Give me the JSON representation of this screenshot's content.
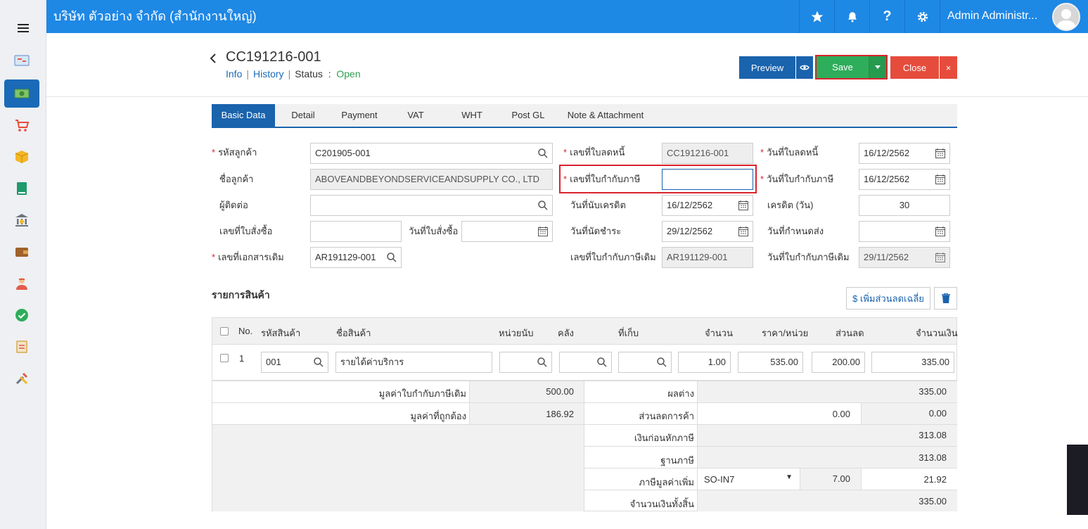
{
  "app": {
    "company": "บริษัท ตัวอย่าง จำกัด (สำนักงานใหญ่)",
    "user": "Admin Administr..."
  },
  "sidebar": {
    "items": [
      {
        "icon": "dashboard-icon"
      },
      {
        "icon": "money-icon",
        "active": true
      },
      {
        "icon": "cart-icon"
      },
      {
        "icon": "box-icon"
      },
      {
        "icon": "book-icon"
      },
      {
        "icon": "bank-icon"
      },
      {
        "icon": "wallet-icon"
      },
      {
        "icon": "user-icon"
      },
      {
        "icon": "approve-icon"
      },
      {
        "icon": "transfer-icon"
      },
      {
        "icon": "tools-icon"
      }
    ]
  },
  "header": {
    "doc_no": "CC191216-001",
    "info": "Info",
    "history": "History",
    "status_label": "Status",
    "status_colon": ":",
    "status_value": "Open",
    "sep": "|"
  },
  "actions": {
    "preview": "Preview",
    "save": "Save",
    "close": "Close"
  },
  "tabs": [
    "Basic Data",
    "Detail",
    "Payment",
    "VAT",
    "WHT",
    "Post GL",
    "Note & Attachment"
  ],
  "form": {
    "customer_code_label": "รหัสลูกค้า",
    "customer_code": "C201905-001",
    "customer_name_label": "ชื่อลูกค้า",
    "customer_name": "ABOVEANDBEYONDSERVICEANDSUPPLY CO., LTD",
    "contact_label": "ผู้ติดต่อ",
    "contact": "",
    "po_no_label": "เลขที่ใบสั่งซื้อ",
    "po_no": "",
    "po_date_label": "วันที่ใบสั่งซื้อ",
    "po_date": "",
    "ref_doc_label": "เลขที่เอกสารเดิม",
    "ref_doc": "AR191129-001",
    "cn_no_label": "เลขที่ใบลดหนี้",
    "cn_no": "CC191216-001",
    "tax_inv_no_label": "เลขที่ใบกำกับภาษี",
    "tax_inv_no": "",
    "credit_start_label": "วันที่นับเครดิต",
    "credit_start": "16/12/2562",
    "due_date_label": "วันที่นัดชำระ",
    "due_date": "29/12/2562",
    "ref_tax_inv_label": "เลขที่ใบกำกับภาษีเดิม",
    "ref_tax_inv": "AR191129-001",
    "cn_date_label": "วันที่ใบลดหนี้",
    "cn_date": "16/12/2562",
    "tax_inv_date_label": "วันที่ใบกำกับภาษี",
    "tax_inv_date": "16/12/2562",
    "credit_days_label": "เครดิต (วัน)",
    "credit_days": "30",
    "delivery_date_label": "วันที่กำหนดส่ง",
    "delivery_date": "",
    "ref_tax_inv_date_label": "วันที่ใบกำกับภาษีเดิม",
    "ref_tax_inv_date": "29/11/2562"
  },
  "items": {
    "title": "รายการสินค้า",
    "add_discount": "$ เพิ่มส่วนลดเฉลี่ย",
    "columns": [
      "No.",
      "รหัสสินค้า",
      "ชื่อสินค้า",
      "หน่วยนับ",
      "คลัง",
      "ที่เก็บ",
      "จำนวน",
      "ราคา/หน่วย",
      "ส่วนลด",
      "จำนวนเงิน"
    ],
    "rows": [
      {
        "no": "1",
        "code": "001",
        "name": "รายได้ค่าบริการ",
        "unit": "",
        "warehouse": "",
        "location": "",
        "qty": "1.00",
        "price": "535.00",
        "discount": "200.00",
        "amount": "335.00"
      }
    ]
  },
  "summary": {
    "orig_tax_value_label": "มูลค่าใบกำกับภาษีเดิม",
    "orig_tax_value": "500.00",
    "correct_value_label": "มูลค่าที่ถูกต้อง",
    "correct_value": "186.92",
    "diff_label": "ผลต่าง",
    "diff": "335.00",
    "trade_discount_label": "ส่วนลดการค้า",
    "trade_discount_input": "0.00",
    "trade_discount": "0.00",
    "before_tax_label": "เงินก่อนหักภาษี",
    "before_tax": "313.08",
    "tax_base_label": "ฐานภาษี",
    "tax_base": "313.08",
    "vat_label": "ภาษีมูลค่าเพิ่ม",
    "vat_code": "SO-IN7",
    "vat_rate": "7.00",
    "vat_amount": "21.92",
    "total_label": "จำนวนเงินทั้งสิ้น",
    "total": "335.00"
  },
  "colors": {
    "topbar": "#1e88e5",
    "primary": "#1a63ad",
    "save": "#2ead5a",
    "close": "#e64c3c",
    "highlight": "#d9232d",
    "status_open": "#2e9e4f"
  }
}
